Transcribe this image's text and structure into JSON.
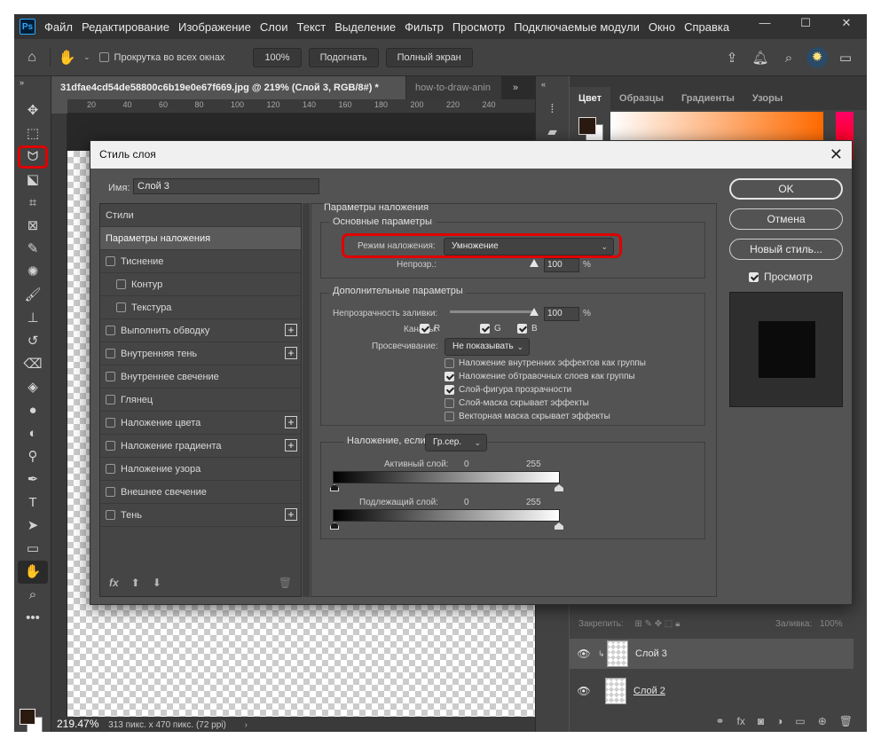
{
  "app": {
    "logo": "Ps",
    "menu": [
      "Файл",
      "Редактирование",
      "Изображение",
      "Слои",
      "Текст",
      "Выделение",
      "Фильтр",
      "Просмотр",
      "Подключаемые модули",
      "Окно",
      "Справка"
    ],
    "window_controls": [
      "—",
      "☐",
      "✕"
    ]
  },
  "options_bar": {
    "scroll_all_label": "Прокрутка во всех окнах",
    "zoom_btn": "100%",
    "fit_btn": "Подогнать",
    "fullscreen_btn": "Полный экран"
  },
  "doc": {
    "tabs": [
      "31dfae4cd54de58800c6b19e0e67f669.jpg @ 219% (Слой 3, RGB/8#) *",
      "how-to-draw-anin"
    ],
    "ruler_ticks": [
      "20",
      "40",
      "60",
      "80",
      "100",
      "120",
      "140",
      "160",
      "180",
      "200",
      "220",
      "240"
    ],
    "zoom": "219.47%",
    "status_text": "313 пикс. x 470 пикс. (72 ppi)"
  },
  "right_panel": {
    "tabs": [
      "Цвет",
      "Образцы",
      "Градиенты",
      "Узоры"
    ],
    "lock_label": "Закрепить:",
    "fill_label": "Заливка:",
    "fill_value": "100%",
    "layers": [
      {
        "name": "Слой 3",
        "selected": true
      },
      {
        "name": "Слой 2",
        "selected": false
      }
    ]
  },
  "dialog": {
    "title": "Стиль слоя",
    "name_label": "Имя:",
    "name_value": "Слой 3",
    "styles_header": "Стили",
    "styles": [
      {
        "label": "Параметры наложения",
        "checkbox": false,
        "selected": true,
        "indent": false,
        "plus": false
      },
      {
        "label": "Тиснение",
        "checkbox": true,
        "indent": false,
        "plus": false
      },
      {
        "label": "Контур",
        "checkbox": true,
        "indent": true,
        "plus": false
      },
      {
        "label": "Текстура",
        "checkbox": true,
        "indent": true,
        "plus": false
      },
      {
        "label": "Выполнить обводку",
        "checkbox": true,
        "indent": false,
        "plus": true
      },
      {
        "label": "Внутренняя тень",
        "checkbox": true,
        "indent": false,
        "plus": true
      },
      {
        "label": "Внутреннее свечение",
        "checkbox": true,
        "indent": false,
        "plus": false
      },
      {
        "label": "Глянец",
        "checkbox": true,
        "indent": false,
        "plus": false
      },
      {
        "label": "Наложение цвета",
        "checkbox": true,
        "indent": false,
        "plus": true
      },
      {
        "label": "Наложение градиента",
        "checkbox": true,
        "indent": false,
        "plus": true
      },
      {
        "label": "Наложение узора",
        "checkbox": true,
        "indent": false,
        "plus": false
      },
      {
        "label": "Внешнее свечение",
        "checkbox": true,
        "indent": false,
        "plus": false
      },
      {
        "label": "Тень",
        "checkbox": true,
        "indent": false,
        "plus": true
      }
    ],
    "fx_label": "fx",
    "blend_params_title": "Параметры наложения",
    "basic_title": "Основные параметры",
    "blend_mode_label": "Режим наложения:",
    "blend_mode_value": "Умножение",
    "opacity_label": "Непрозр.:",
    "opacity_value": "100",
    "advanced_title": "Дополнительные параметры",
    "fill_opacity_label": "Непрозрачность заливки:",
    "fill_opacity_value": "100",
    "percent": "%",
    "channels_label": "Каналы:",
    "channels": [
      "R",
      "G",
      "B"
    ],
    "knockout_label": "Просвечивание:",
    "knockout_value": "Не показывать",
    "options": [
      {
        "label": "Наложение внутренних эффектов как группы",
        "checked": false
      },
      {
        "label": "Наложение обтравочных слоев как группы",
        "checked": true
      },
      {
        "label": "Слой-фигура прозрачности",
        "checked": true
      },
      {
        "label": "Слой-маска скрывает эффекты",
        "checked": false
      },
      {
        "label": "Векторная маска скрывает эффекты",
        "checked": false
      }
    ],
    "blend_if_label": "Наложение, если:",
    "blend_if_value": "Гр.сер.",
    "this_layer_label": "Активный слой:",
    "underlying_label": "Подлежащий слой:",
    "range_min": "0",
    "range_max": "255",
    "ok_btn": "OK",
    "cancel_btn": "Отмена",
    "new_style_btn": "Новый стиль...",
    "preview_label": "Просмотр"
  }
}
